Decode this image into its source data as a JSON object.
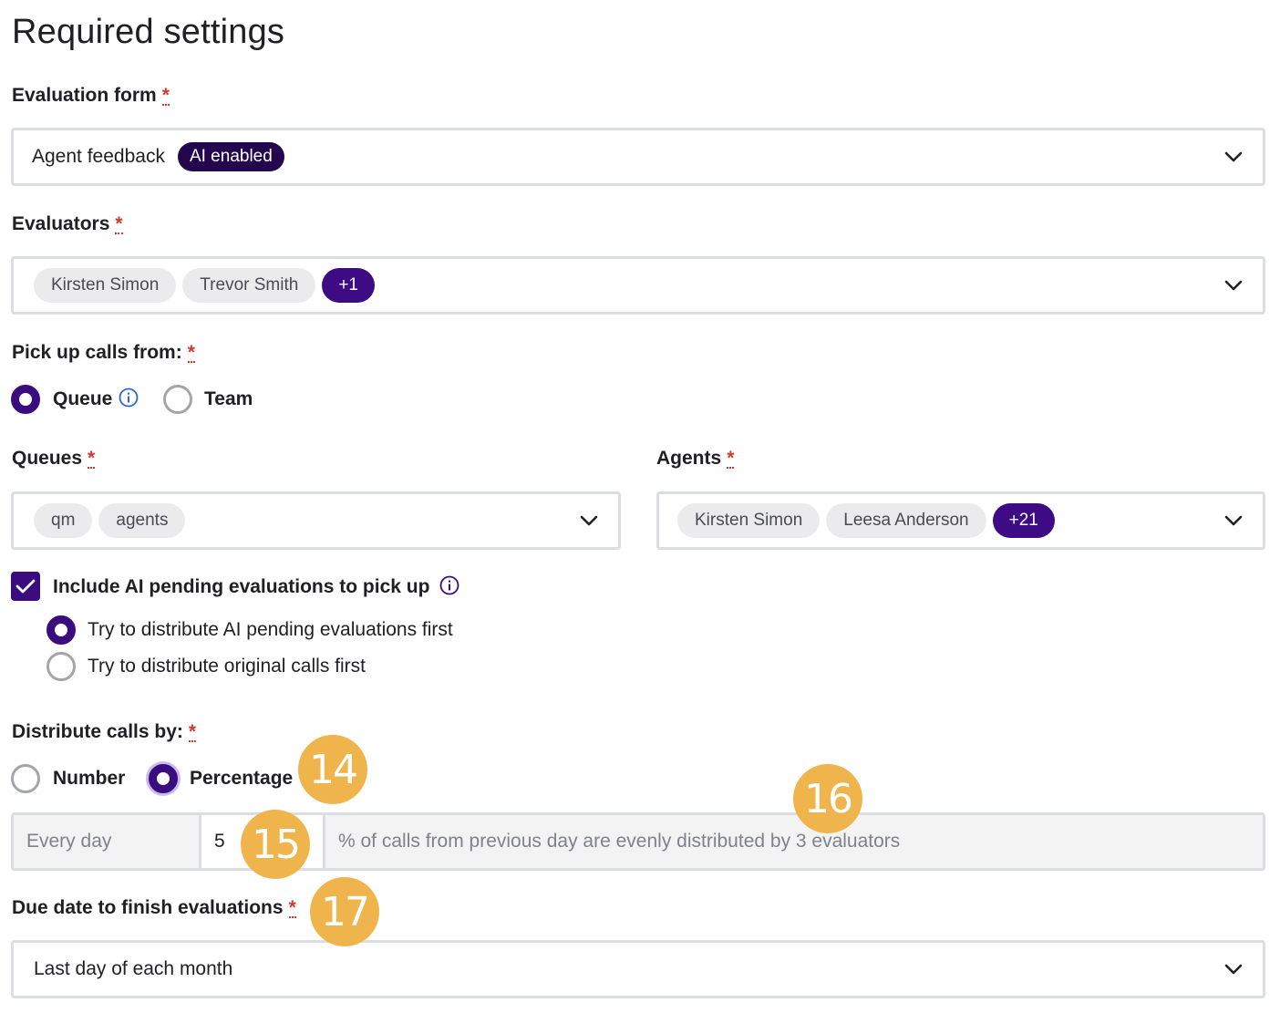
{
  "page": {
    "title": "Required settings"
  },
  "evaluation_form": {
    "label": "Evaluation form",
    "required_mark": "*",
    "value": "Agent feedback",
    "badge": "AI enabled"
  },
  "evaluators": {
    "label": "Evaluators",
    "required_mark": "*",
    "chips": [
      "Kirsten Simon",
      "Trevor Smith"
    ],
    "more": "+1"
  },
  "pick_up": {
    "label": "Pick up calls from:",
    "required_mark": "*",
    "options": [
      {
        "label": "Queue",
        "selected": true
      },
      {
        "label": "Team",
        "selected": false
      }
    ]
  },
  "queues": {
    "label": "Queues",
    "required_mark": "*",
    "chips": [
      "qm",
      "agents"
    ]
  },
  "agents": {
    "label": "Agents",
    "required_mark": "*",
    "chips": [
      "Kirsten Simon",
      "Leesa Anderson"
    ],
    "more": "+21"
  },
  "ai_pending": {
    "label": "Include AI pending evaluations to pick up",
    "checked": true,
    "options": [
      {
        "label": "Try to distribute AI pending evaluations first",
        "selected": true
      },
      {
        "label": "Try to distribute original calls first",
        "selected": false
      }
    ]
  },
  "distribute": {
    "label": "Distribute calls by:",
    "required_mark": "*",
    "options": [
      {
        "label": "Number",
        "selected": false
      },
      {
        "label": "Percentage",
        "selected": true
      }
    ],
    "frequency": "Every day",
    "amount": "5",
    "description": "% of calls from previous day are evenly distributed by 3 evaluators"
  },
  "due_date": {
    "label": "Due date to finish evaluations",
    "required_mark": "*",
    "value": "Last day of each month"
  },
  "callouts": [
    "14",
    "15",
    "16",
    "17"
  ],
  "colors": {
    "accent": "#3a0c7f",
    "badge": "#24064f",
    "callout": "#f0b44c",
    "required": "#d33a2c",
    "border": "#dcdde0"
  }
}
